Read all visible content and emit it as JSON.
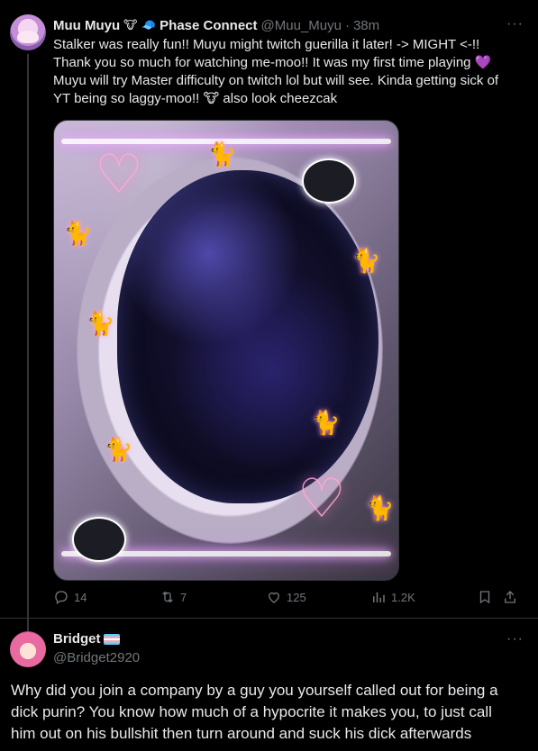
{
  "tweet1": {
    "display_name": "Muu Muyu",
    "name_emojis": [
      "🐮",
      "🧢"
    ],
    "affiliation": "Phase Connect",
    "handle": "@Muu_Muyu",
    "separator": "·",
    "time": "38m",
    "body_lines": [
      "Stalker was really fun!! Muyu might twitch guerilla it later! -> MIGHT <-!!",
      "Thank you so much for watching me-moo!! It was my first time playing 💜",
      "Muyu will try Master difficulty on twitch lol but will see. Kinda getting sick of",
      "YT being so laggy-moo!! 🐮 also look cheezcak"
    ],
    "more_label": "···",
    "stats": {
      "replies": "14",
      "reposts": "7",
      "likes": "125",
      "views": "1.2K"
    }
  },
  "tweet2": {
    "display_name": "Bridget",
    "handle": "@Bridget2920",
    "more_label": "···",
    "body_lines": [
      "Why did you join a company by a guy you yourself called out for being a",
      "dick purin? You know how much of a hypocrite it makes you, to just call",
      "him out on his bullshit then turn around and suck his dick afterwards"
    ]
  },
  "colors": {
    "background": "#000000",
    "text": "#e7e9ea",
    "secondary": "#71767b",
    "divider": "#2f3336"
  },
  "icons": [
    "reply-icon",
    "repost-icon",
    "like-icon",
    "views-icon",
    "bookmark-icon",
    "share-icon",
    "more-icon"
  ]
}
